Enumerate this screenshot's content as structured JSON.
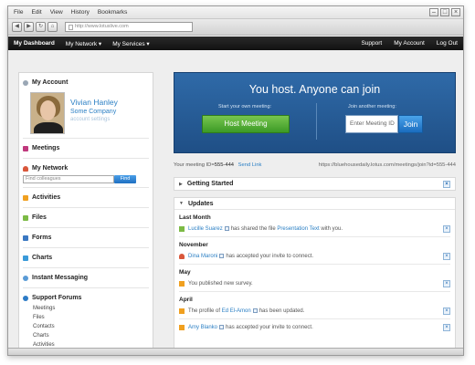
{
  "menu": [
    "File",
    "Edit",
    "View",
    "History",
    "Bookmarks"
  ],
  "window_controls": [
    "–",
    "□",
    "×"
  ],
  "nav": {
    "back": "◀",
    "forward": "▶",
    "reload": "↻",
    "home": "⌂"
  },
  "url": "http://www.lotuslive.com",
  "appbar": {
    "left": [
      "My Dashboard",
      "My Network ▾",
      "My Services ▾"
    ],
    "right": [
      "Support",
      "My Account",
      "Log Out"
    ]
  },
  "sidebar": {
    "account_heading": "My Account",
    "user_name": "Vivian Hanley",
    "company": "Some Company",
    "account_settings": "account settings",
    "meetings": "Meetings",
    "network": "My Network",
    "find_placeholder": "Find colleagues",
    "find_button": "Find",
    "activities": "Activities",
    "files": "Files",
    "forms": "Forms",
    "charts": "Charts",
    "instant_messaging": "Instant Messaging",
    "support_forums": "Support Forums",
    "forum_items": [
      "Meetings",
      "Files",
      "Contacts",
      "Charts",
      "Activities"
    ]
  },
  "hero": {
    "title": "You host. Anyone can join",
    "start_label": "Start your own meeting:",
    "join_label": "Join another meeting:",
    "host_button": "Host Meeting",
    "meeting_id_placeholder": "Enter Meeting ID",
    "join_button": "Join"
  },
  "meeting_info": {
    "label": "Your meeting ID=",
    "id": "555-444",
    "send_link": "Send Link",
    "url": "https://bluehousedaily.lotus.com/meetings/join?id=555-444"
  },
  "getting_started": "Getting Started",
  "updates": {
    "title": "Updates",
    "groups": [
      {
        "month": "Last Month",
        "items": [
          {
            "pre": "",
            "link1": "Lucille Suarez",
            "mid": "has shared the file",
            "link2": "Presentation Text",
            "post": "with you."
          }
        ]
      },
      {
        "month": "November",
        "items": [
          {
            "pre": "",
            "link1": "Dina Maroni",
            "mid": "has accepted your invite to connect.",
            "link2": "",
            "post": ""
          }
        ]
      },
      {
        "month": "May",
        "items": [
          {
            "pre": "You published new survey.",
            "link1": "",
            "mid": "",
            "link2": "",
            "post": ""
          }
        ]
      },
      {
        "month": "April",
        "items": [
          {
            "pre": "The profile of",
            "link1": "Ed El-Amon",
            "mid": "has been updated.",
            "link2": "",
            "post": ""
          },
          {
            "pre": "",
            "link1": "Amy Blanko",
            "mid": "has accepted your invite to connect.",
            "link2": "",
            "post": ""
          }
        ]
      }
    ]
  },
  "colors": {
    "accent_blue": "#2a7fc4",
    "hero_blue": "#2f6aa8",
    "host_green": "#4fae34",
    "appbar": "#1a1a1a"
  }
}
